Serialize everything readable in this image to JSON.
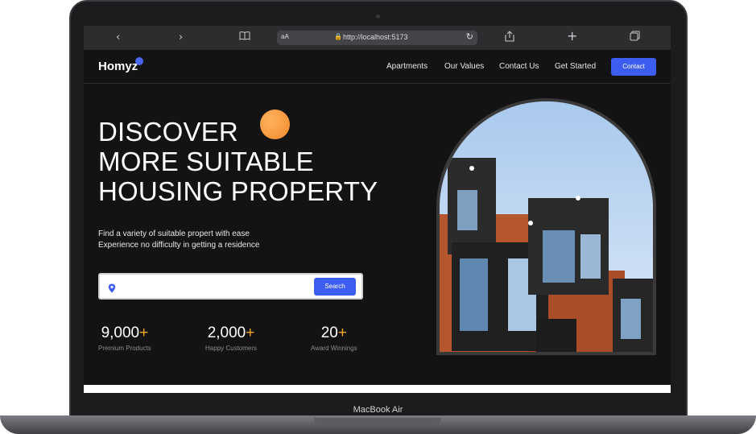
{
  "browser": {
    "text_size_label": "aA",
    "url": "http://localhost:5173"
  },
  "nav": {
    "logo": "Homyz",
    "links": [
      "Apartments",
      "Our Values",
      "Contact Us",
      "Get Started"
    ],
    "contact_button": "Contact"
  },
  "hero": {
    "title_lines": [
      "DISCOVER",
      "MORE SUITABLE",
      "HOUSING PROPERTY"
    ],
    "description_lines": [
      "Find a variety of suitable propert with ease",
      "Experience no difficulty in getting a residence"
    ],
    "search": {
      "value": "",
      "button": "Search"
    },
    "stats": [
      {
        "value": "9,000",
        "suffix": "+",
        "label": "Premium Products"
      },
      {
        "value": "2,000",
        "suffix": "+",
        "label": "Happy Customers"
      },
      {
        "value": "20",
        "suffix": "+",
        "label": "Award Winnings"
      }
    ]
  },
  "device": {
    "label": "MacBook Air"
  },
  "colors": {
    "accent": "#3d5df0",
    "orange": "#f28a2c",
    "background": "#131313"
  }
}
